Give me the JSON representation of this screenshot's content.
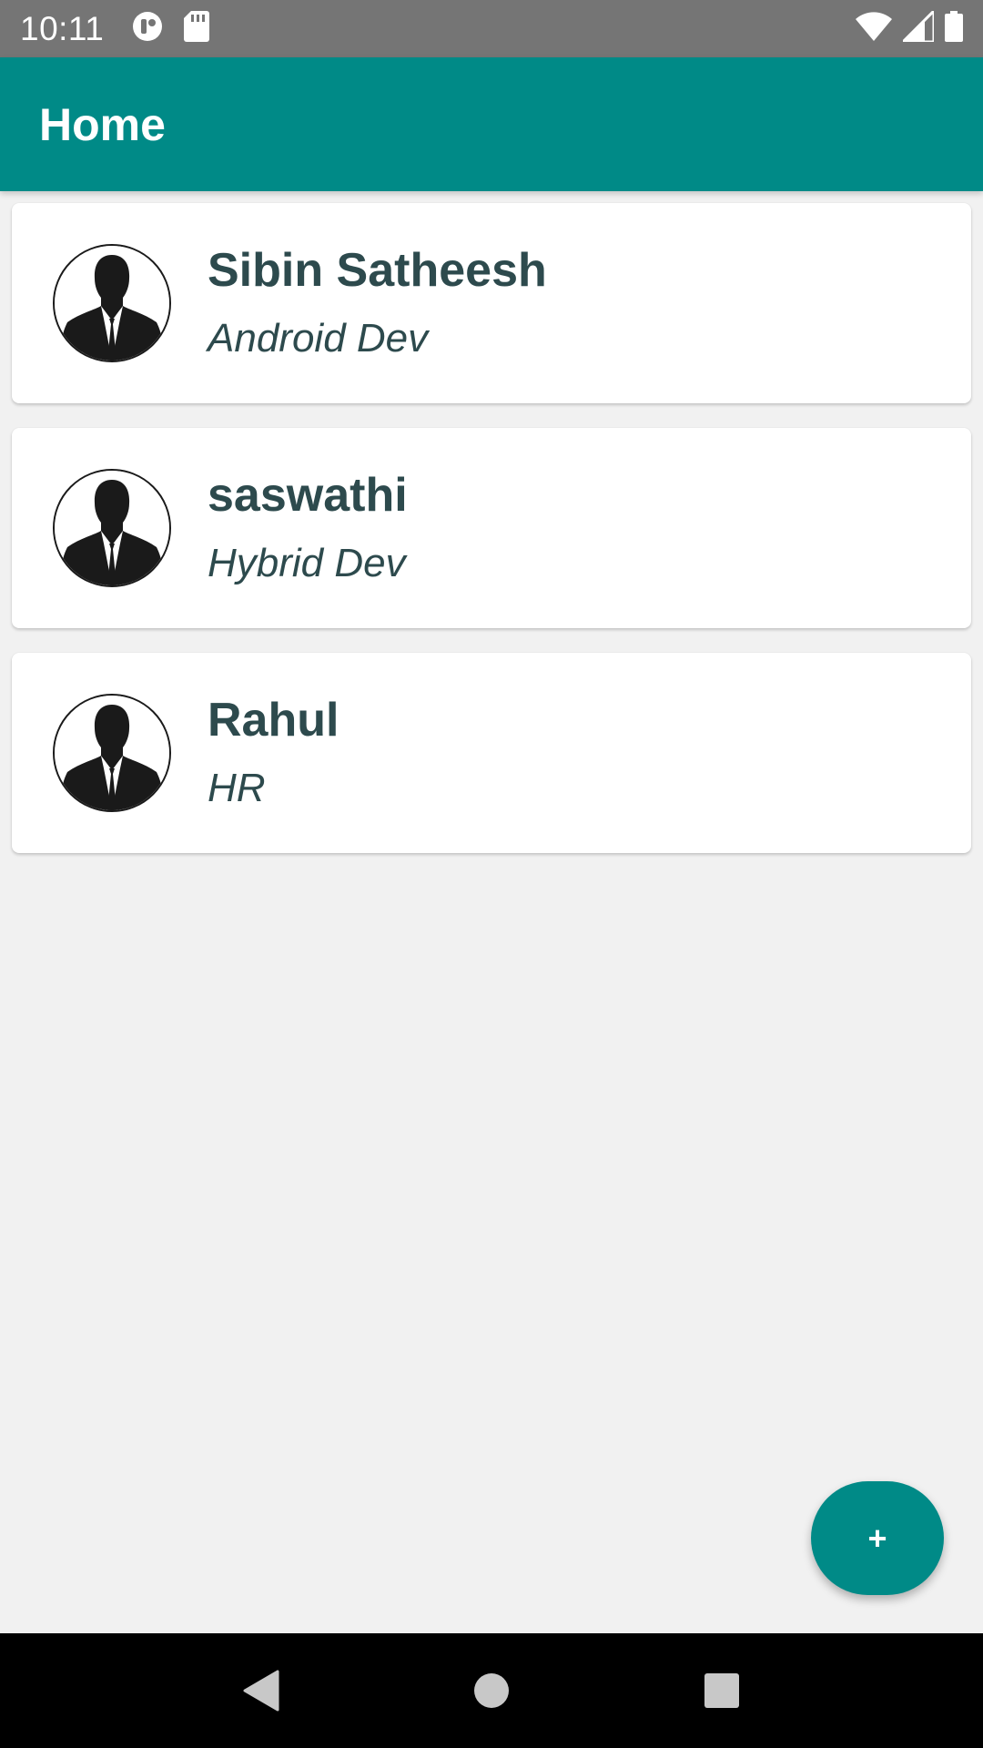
{
  "status_bar": {
    "time": "10:11",
    "left_icons": [
      "do-not-disturb-icon",
      "sd-card-icon"
    ],
    "right_icons": [
      "wifi-icon",
      "signal-icon",
      "battery-icon"
    ]
  },
  "app_bar": {
    "title": "Home"
  },
  "employees": [
    {
      "name": "Sibin Satheesh",
      "role": "Android Dev",
      "avatar": "person-silhouette-icon"
    },
    {
      "name": "saswathi",
      "role": "Hybrid Dev",
      "avatar": "person-silhouette-icon"
    },
    {
      "name": "Rahul",
      "role": "HR",
      "avatar": "person-silhouette-icon"
    }
  ],
  "fab": {
    "label": "+"
  },
  "nav_bar": {
    "buttons": [
      "back-icon",
      "home-icon",
      "recents-icon"
    ]
  },
  "colors": {
    "primary": "#008a87",
    "status_bar": "#757575",
    "text": "#2d4a4d",
    "background": "#f1f1f1"
  }
}
